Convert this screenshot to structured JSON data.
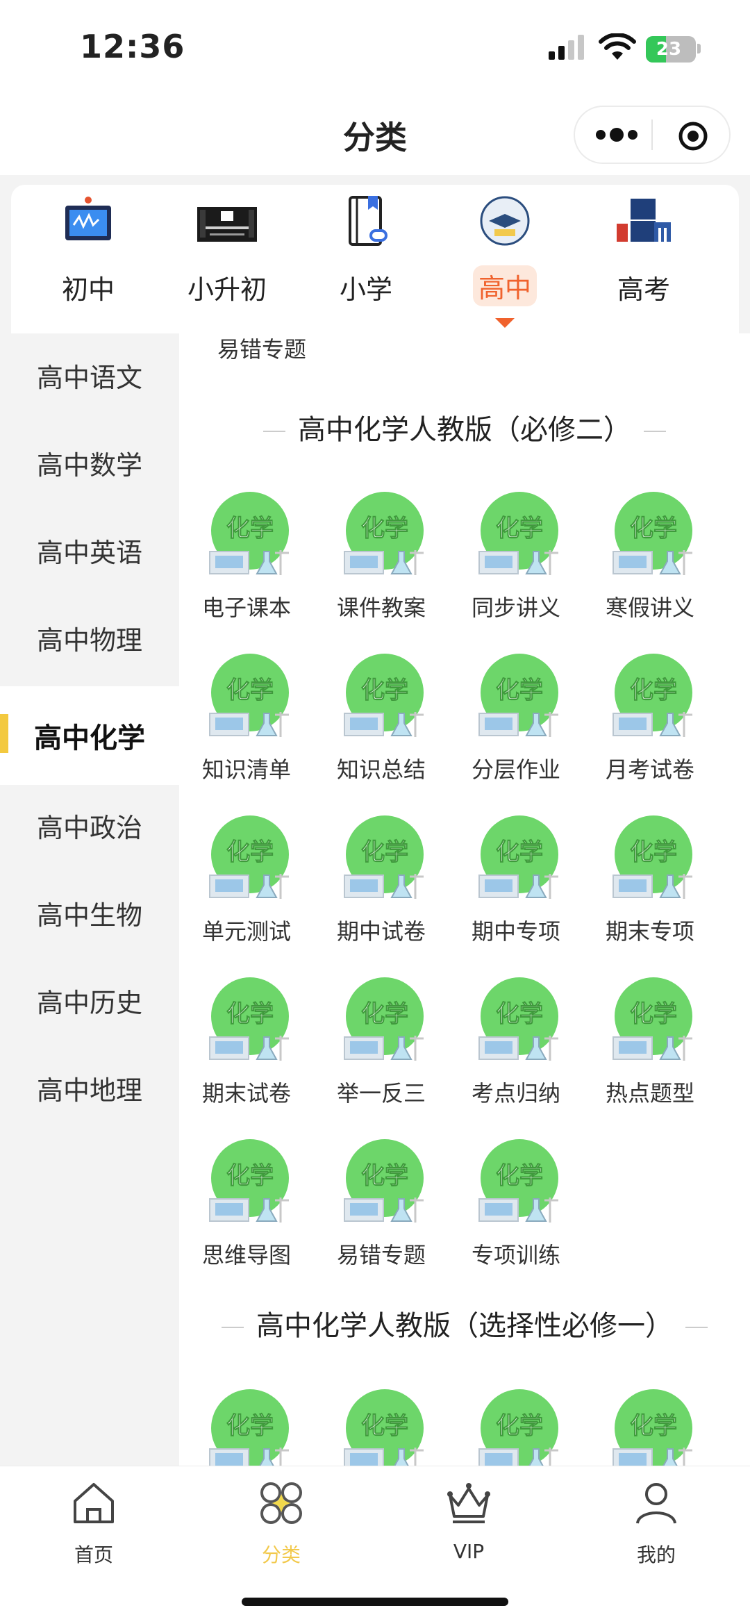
{
  "status_bar": {
    "time": "12:36",
    "battery": "23"
  },
  "header": {
    "title": "分类"
  },
  "categories": [
    {
      "label": "初中",
      "icon": "whiteboard-icon"
    },
    {
      "label": "小升初",
      "icon": "banner-icon"
    },
    {
      "label": "小学",
      "icon": "bookmark-book-icon"
    },
    {
      "label": "高中",
      "icon": "highschool-badge-icon",
      "active": true
    },
    {
      "label": "高考",
      "icon": "gaokao-icon"
    }
  ],
  "sidebar": {
    "items": [
      "高中语文",
      "高中数学",
      "高中英语",
      "高中物理",
      "高中化学",
      "高中政治",
      "高中生物",
      "高中历史",
      "高中地理"
    ],
    "active": "高中化学"
  },
  "content": {
    "top_label": "易错专题",
    "badge_text": "化学",
    "badge_color": "#6dd66a",
    "sections": [
      {
        "title": "高中化学人教版（必修二）",
        "items": [
          "电子课本",
          "课件教案",
          "同步讲义",
          "寒假讲义",
          "知识清单",
          "知识总结",
          "分层作业",
          "月考试卷",
          "单元测试",
          "期中试卷",
          "期中专项",
          "期末专项",
          "期末试卷",
          "举一反三",
          "考点归纳",
          "热点题型",
          "思维导图",
          "易错专题",
          "专项训练"
        ]
      },
      {
        "title": "高中化学人教版（选择性必修一）",
        "items": [
          "",
          "",
          "",
          ""
        ]
      }
    ]
  },
  "tabbar": {
    "items": [
      {
        "label": "首页",
        "icon": "home-icon"
      },
      {
        "label": "分类",
        "icon": "category-icon",
        "active": true
      },
      {
        "label": "VIP",
        "icon": "crown-icon"
      },
      {
        "label": "我的",
        "icon": "user-icon"
      }
    ]
  },
  "colors": {
    "accent_orange": "#f0622d",
    "accent_yellow": "#f2c94c",
    "sidebar_bg": "#f3f3f3"
  }
}
